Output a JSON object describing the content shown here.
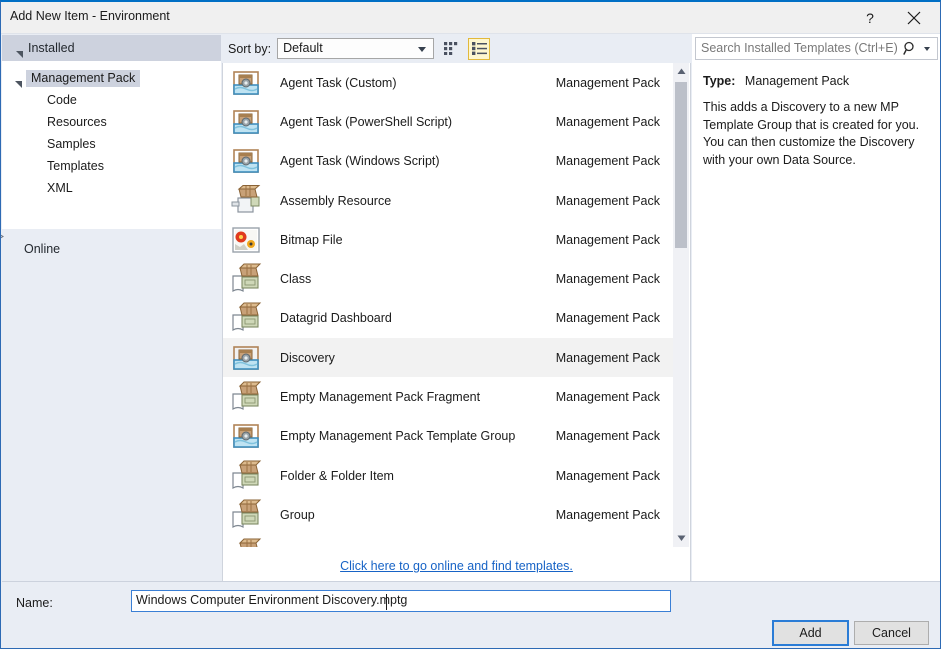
{
  "window": {
    "title": "Add New Item - Environment",
    "help_label": "?",
    "help_icon": "question-mark-icon",
    "close_icon": "close-icon"
  },
  "left_pane": {
    "installed": {
      "label": "Installed",
      "expanded": true,
      "chevron_icon": "chevron-down-icon"
    },
    "tree": {
      "root": {
        "label": "Management Pack",
        "selected": true,
        "chevron_icon": "chevron-down-icon"
      },
      "children": [
        {
          "label": "Code"
        },
        {
          "label": "Resources"
        },
        {
          "label": "Samples"
        },
        {
          "label": "Templates"
        },
        {
          "label": "XML"
        }
      ]
    },
    "online": {
      "label": "Online",
      "expanded": false,
      "chevron_icon": "chevron-right-icon"
    }
  },
  "toolbar": {
    "sort_label": "Sort by:",
    "sort_value": "Default",
    "sort_options": [
      "Default"
    ],
    "sort_chevron_icon": "chevron-down-icon",
    "view_tiles_icon": "grid-view-icon",
    "view_list_icon": "list-view-icon",
    "view_active": "list"
  },
  "templates": {
    "kind_column": "Management Pack",
    "items": [
      {
        "name": "Agent Task (Custom)",
        "kind": "Management Pack",
        "icon": "template-group-icon",
        "selected": false
      },
      {
        "name": "Agent Task (PowerShell Script)",
        "kind": "Management Pack",
        "icon": "template-group-icon",
        "selected": false
      },
      {
        "name": "Agent Task (Windows Script)",
        "kind": "Management Pack",
        "icon": "template-group-icon",
        "selected": false
      },
      {
        "name": "Assembly Resource",
        "kind": "Management Pack",
        "icon": "assembly-resource-icon",
        "selected": false
      },
      {
        "name": "Bitmap File",
        "kind": "Management Pack",
        "icon": "bitmap-file-icon",
        "selected": false
      },
      {
        "name": "Class",
        "kind": "Management Pack",
        "icon": "management-pack-fragment-icon",
        "selected": false
      },
      {
        "name": "Datagrid Dashboard",
        "kind": "Management Pack",
        "icon": "management-pack-fragment-icon",
        "selected": false
      },
      {
        "name": "Discovery",
        "kind": "Management Pack",
        "icon": "template-group-icon",
        "selected": true
      },
      {
        "name": "Empty Management Pack Fragment",
        "kind": "Management Pack",
        "icon": "management-pack-fragment-icon",
        "selected": false
      },
      {
        "name": "Empty Management Pack Template Group",
        "kind": "Management Pack",
        "icon": "template-group-icon",
        "selected": false
      },
      {
        "name": "Folder & Folder Item",
        "kind": "Management Pack",
        "icon": "management-pack-fragment-icon",
        "selected": false
      },
      {
        "name": "Group",
        "kind": "Management Pack",
        "icon": "management-pack-fragment-icon",
        "selected": false
      },
      {
        "name": "",
        "kind": "",
        "icon": "management-pack-fragment-icon",
        "selected": false
      }
    ],
    "scrollbar": {
      "up_icon": "scroll-up-icon",
      "down_icon": "scroll-down-icon"
    },
    "online_link": "Click here to go online and find templates."
  },
  "details": {
    "search_placeholder": "Search Installed Templates (Ctrl+E)",
    "search_value": "",
    "search_icon": "search-icon",
    "search_dropdown_icon": "chevron-down-icon",
    "type_label": "Type:",
    "type_value": "Management Pack",
    "description": "This adds a Discovery to a new MP Template Group that is created for you. You can then customize the Discovery with your own Data Source."
  },
  "footer": {
    "name_label": "Name:",
    "name_value": "Windows Computer Environment Discovery.mptg",
    "add_label": "Add",
    "cancel_label": "Cancel"
  },
  "colors": {
    "accent": "#006fc5",
    "dialog_bg": "#e9edf4",
    "selected_row": "#f2f2f2",
    "tree_selection": "#cdd2de",
    "link": "#1763c6",
    "toggle_active_bg": "#fdf6cf",
    "toggle_active_border": "#e2b93b"
  }
}
